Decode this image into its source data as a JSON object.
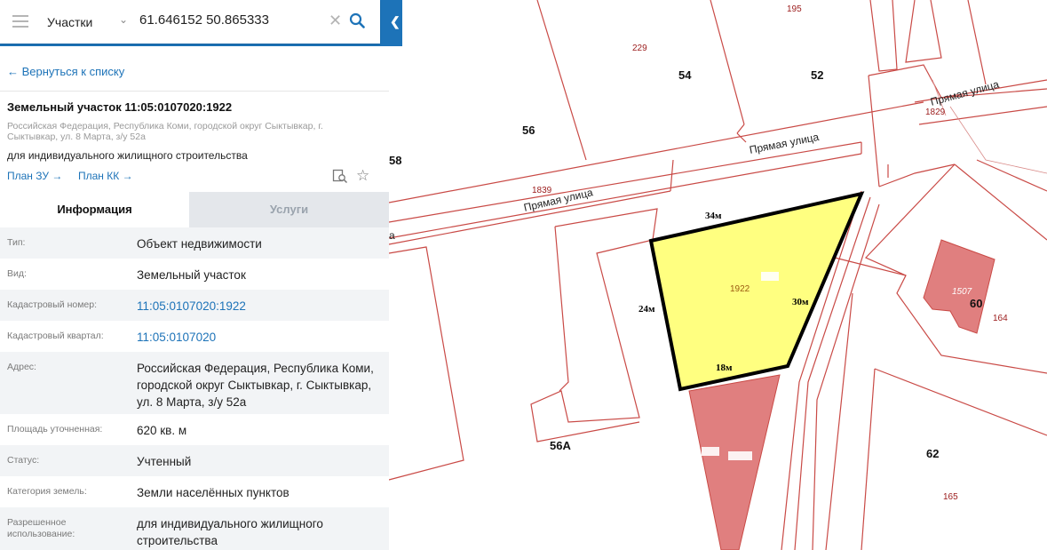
{
  "search": {
    "layer_select": "Участки",
    "coordinates": "61.646152 50.865333"
  },
  "panel": {
    "back_link": "← Вернуться к списку",
    "title": "Земельный участок 11:05:0107020:1922",
    "address_small": "Российская Федерация, Республика Коми, городской округ Сыктывкар, г. Сыктывкар, ул. 8 Марта, з/у 52а",
    "purpose": "для индивидуального жилищного строительства",
    "plan_zu": "План ЗУ →",
    "plan_kk": "План КК →",
    "tabs": {
      "info": "Информация",
      "services": "Услуги"
    },
    "rows": [
      {
        "label": "Тип:",
        "value": "Объект недвижимости"
      },
      {
        "label": "Вид:",
        "value": "Земельный участок"
      },
      {
        "label": "Кадастровый номер:",
        "value": "11:05:0107020:1922"
      },
      {
        "label": "Кадастровый квартал:",
        "value": "11:05:0107020"
      },
      {
        "label": "Адрес:",
        "value": "Российская Федерация, Республика Коми, городской округ Сыктывкар, г. Сыктывкар, ул. 8 Марта, з/у 52а"
      },
      {
        "label": "Площадь уточненная:",
        "value": "620 кв. м"
      },
      {
        "label": "Статус:",
        "value": "Учтенный"
      },
      {
        "label": "Категория земель:",
        "value": "Земли населённых пунктов"
      },
      {
        "label": "Разрешенное использование:",
        "value": "для индивидуального жилищного строительства"
      }
    ]
  },
  "map": {
    "block_labels": [
      "54",
      "52",
      "56",
      "58",
      "56А",
      "60",
      "62"
    ],
    "parcel_labels_red": [
      "195",
      "229",
      "1829",
      "1839",
      "164",
      "165"
    ],
    "building_label": "1507",
    "selected_parcel": "1922",
    "streets": [
      "Прямая улица",
      "Прямая улица",
      "Прямая улица"
    ],
    "street_fragment": "а",
    "dimensions": [
      "34м",
      "24м",
      "30м",
      "18м"
    ],
    "colors": {
      "selected_fill": "#ffff80",
      "building_fill": "#e07f7f",
      "parcel_line": "#c9302c"
    }
  }
}
